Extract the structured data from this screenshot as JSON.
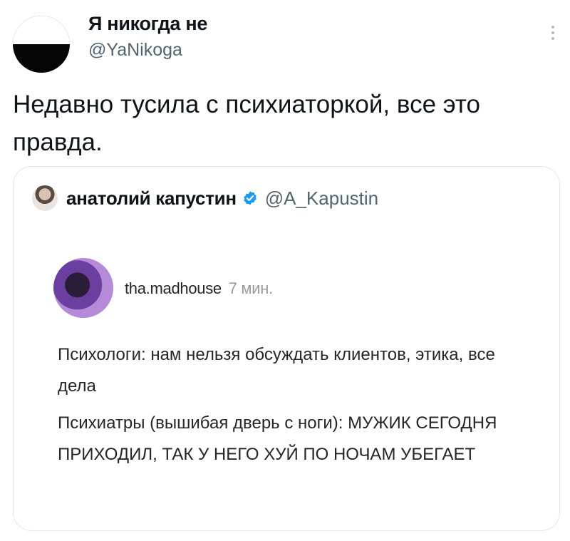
{
  "tweet": {
    "display_name": "Я никогда не",
    "handle": "@YaNikoga",
    "text": "Недавно тусила с психиаторкой, все это правда."
  },
  "quote": {
    "author_name": "анатолий капустин",
    "author_handle": "@A_Kapustin",
    "verified_color": "#1d9bf0",
    "inner_post": {
      "username": "tha.madhouse",
      "time": "7 мин.",
      "paragraph_1": "Психологи: нам нельзя обсуждать клиентов, этика, все дела",
      "paragraph_2": "Психиатры (вышибая дверь с ноги): МУЖИК СЕГОДНЯ ПРИХОДИЛ, ТАК У НЕГО ХУЙ ПО НОЧАМ УБЕГАЕТ"
    }
  },
  "icons": {
    "more": "more-vertical-icon",
    "verified": "verified-badge-icon"
  }
}
